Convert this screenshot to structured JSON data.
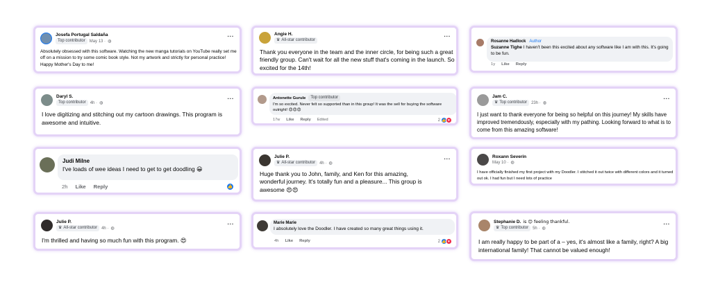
{
  "colors": {
    "card_border": "#e4d3f7",
    "bubble": "#f0f2f5",
    "badge": "#eef0f3",
    "like": "#1877f2",
    "love": "#f02849"
  },
  "icons": {
    "more": "dots-icon",
    "badge": "badge-icon",
    "privacy": "globe-icon"
  },
  "posts": [
    {
      "name": "Josefa Portugal Saldaña",
      "badge": "Top contributor",
      "time": "May 13 · ",
      "text": "Absolutely obsessed with this software. Watching the new manga tutorials on YouTube really set me off on a mission to try some comic book style. Not my artwork and strictly for personal practice! Happy Mother's Day to me!"
    },
    {
      "name": "Angie H.",
      "badge": "All-star contributor",
      "text": "Thank you everyone in the team and the inner circle, for being such a great friendly group. Can't wait for all the new stuff that's coming in the launch. So excited for the 14th!"
    },
    {
      "name": "Rosanne Hadlock",
      "author": "Author",
      "reply_to": "Suzanne Tighe",
      "text": "I haven't been this excited about any software like I am with this. It's going to be fun.",
      "time": "1y",
      "like": "Like",
      "reply": "Reply"
    },
    {
      "name": "Daryl S.",
      "badge": "Top contributor",
      "time": "4h · ",
      "text": "I love digitizing and stitching out my cartoon drawings. This program is awesome and intuitive."
    },
    {
      "name": "Antonette Gurule",
      "badge": "Top contributor",
      "text": "I'm so excited. Never felt so supported than in this group! It was the sell for buying the software outright!",
      "emoji": "😍😍😍",
      "time": "17w",
      "like": "Like",
      "reply": "Reply",
      "edited": "Edited",
      "reactions": "2"
    },
    {
      "name": "Jam C.",
      "badge": "Top contributor",
      "time": "23h · ",
      "text": "I just want to thank everyone for being so helpful on this journey! My skills have improved tremendously, especially with my pathing. Looking forward to what is to come from this amazing software!"
    },
    {
      "name": "Judi Milne",
      "text": "I've loads of wee ideas I need to get to get doodling",
      "emoji": "😀",
      "time": "2h",
      "like": "Like",
      "reply": "Reply"
    },
    {
      "name": "Julie P.",
      "badge": "All-star contributor",
      "time": "4h · ",
      "text": "Huge thank you to John, family, and Ken for this amazing, wonderful journey. It's totally fun and a pleasure... This group is awesome",
      "emoji": "😍😍"
    },
    {
      "name": "Roxann Severin",
      "time": "May 10 · ",
      "text": "I have officially finished my first project with my Doodler.  I stitched it out twice with different colors and it turned out ok. I had fun but I need lots of practice"
    },
    {
      "name": "Julie P.",
      "badge": "All-star contributor",
      "time": "4h · ",
      "text": "I'm thrilled and having so much fun with this program.",
      "emoji": "😍"
    },
    {
      "name": "Marie Marie",
      "text": "I absolutely love the Doodler. I have created so many great things using it.",
      "time": "4h",
      "like": "Like",
      "reply": "Reply",
      "reactions": "2"
    },
    {
      "name": "Stephanie D.",
      "feeling": "is 😊 feeling thankful.",
      "badge": "Top contributor",
      "time": "5h · ",
      "text": "I am really happy to be part of a – yes, it's almost like a family, right? A big international family! That cannot be valued enough!"
    }
  ]
}
